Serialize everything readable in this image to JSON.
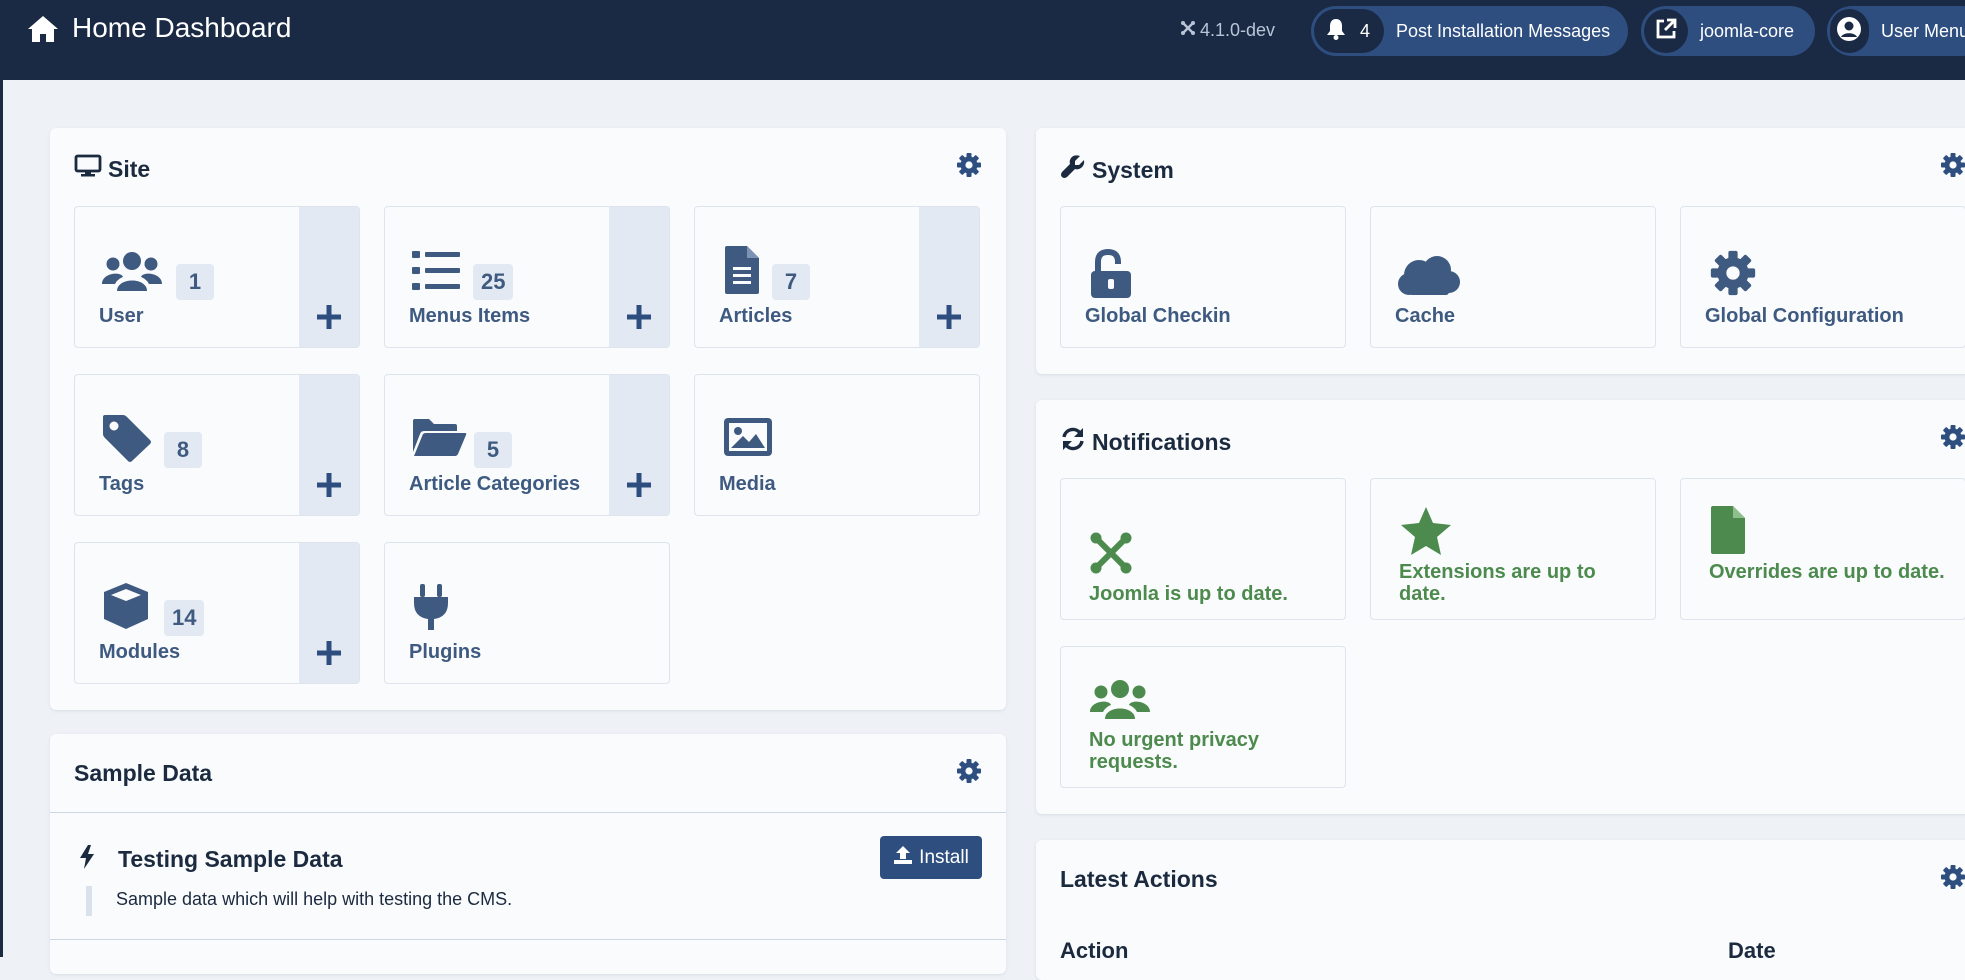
{
  "header": {
    "title": "Home Dashboard",
    "version": "4.1.0-dev",
    "notifications_count": "4",
    "post_install_label": "Post Installation Messages",
    "site_link_label": "joomla-core",
    "user_menu_label": "User Menu"
  },
  "site": {
    "title": "Site",
    "tiles": [
      {
        "label": "User",
        "count": "1"
      },
      {
        "label": "Menus Items",
        "count": "25"
      },
      {
        "label": "Articles",
        "count": "7"
      },
      {
        "label": "Tags",
        "count": "8"
      },
      {
        "label": "Article Categories",
        "count": "5"
      },
      {
        "label": "Media"
      },
      {
        "label": "Modules",
        "count": "14"
      },
      {
        "label": "Plugins"
      }
    ]
  },
  "system": {
    "title": "System",
    "tiles": [
      {
        "label": "Global Checkin"
      },
      {
        "label": "Cache"
      },
      {
        "label": "Global Configuration"
      }
    ]
  },
  "notifications": {
    "title": "Notifications",
    "tiles": [
      {
        "label": "Joomla is up to date."
      },
      {
        "label": "Extensions are up to date."
      },
      {
        "label": "Overrides are up to date."
      },
      {
        "label": "No urgent privacy requests."
      }
    ]
  },
  "sample_data": {
    "title": "Sample Data",
    "item_title": "Testing Sample Data",
    "item_desc": "Sample data which will help with testing the CMS.",
    "install_label": "Install"
  },
  "latest_actions": {
    "title": "Latest Actions",
    "col_action": "Action",
    "col_date": "Date"
  },
  "colors": {
    "header_bg": "#1a2a44",
    "accent": "#2e4e80",
    "tile_text": "#3f5a80",
    "success": "#4d8a4d"
  }
}
